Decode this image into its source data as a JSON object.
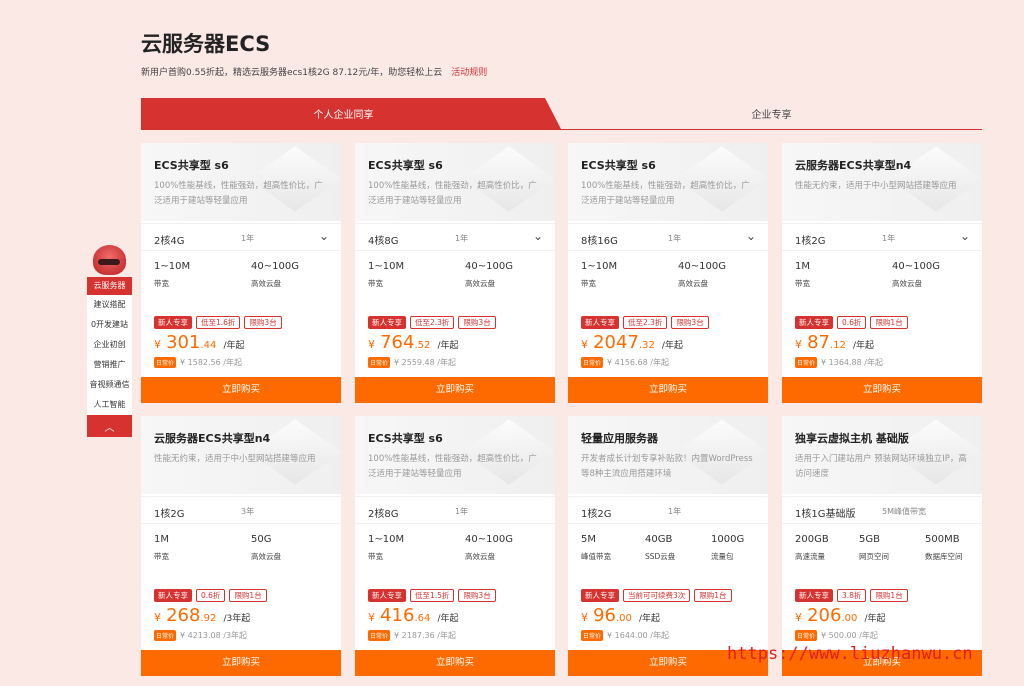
{
  "page": {
    "title": "云服务器ECS",
    "subtitle": "新用户首购0.55折起，精选云服务器ecs1核2G 87.12元/年，助您轻松上云",
    "rule_link": "活动规则"
  },
  "tabs": [
    "个人企业同享",
    "企业专享"
  ],
  "side_nav": {
    "active": "云服务器",
    "items": [
      "建议搭配",
      "0开发建站",
      "企业初创",
      "营销推广",
      "音视频通信",
      "人工智能"
    ]
  },
  "colors": {
    "brand_red": "#d6322f",
    "orange": "#ff6a00"
  },
  "watermark": "https://www.liuzhanwu.cn",
  "cards": [
    {
      "name": "ECS共享型 s6",
      "desc": "100%性能基线，性能强劲，超高性价比，广泛适用于建站等轻量应用",
      "config": "2核4G",
      "period": "1年",
      "chevron": true,
      "specs": [
        {
          "v": "1~10M",
          "l": "带宽"
        },
        {
          "v": "40~100G",
          "l": "高效云盘"
        }
      ],
      "tags": [
        "新人专享",
        "低至1.6折",
        "限购3台"
      ],
      "price_int": "301",
      "price_dec": ".44",
      "unit": "/年起",
      "orig_badge": "日常价",
      "orig": "¥ 1582.56 /年起",
      "buy": "立即购买"
    },
    {
      "name": "ECS共享型 s6",
      "desc": "100%性能基线，性能强劲，超高性价比，广泛适用于建站等轻量应用",
      "config": "4核8G",
      "period": "1年",
      "chevron": true,
      "specs": [
        {
          "v": "1~10M",
          "l": "带宽"
        },
        {
          "v": "40~100G",
          "l": "高效云盘"
        }
      ],
      "tags": [
        "新人专享",
        "低至2.3折",
        "限购3台"
      ],
      "price_int": "764",
      "price_dec": ".52",
      "unit": "/年起",
      "orig_badge": "日常价",
      "orig": "¥ 2559.48 /年起",
      "buy": "立即购买"
    },
    {
      "name": "ECS共享型 s6",
      "desc": "100%性能基线，性能强劲，超高性价比，广泛适用于建站等轻量应用",
      "config": "8核16G",
      "period": "1年",
      "chevron": true,
      "specs": [
        {
          "v": "1~10M",
          "l": "带宽"
        },
        {
          "v": "40~100G",
          "l": "高效云盘"
        }
      ],
      "tags": [
        "新人专享",
        "低至2.3折",
        "限购3台"
      ],
      "price_int": "2047",
      "price_dec": ".32",
      "unit": "/年起",
      "orig_badge": "日常价",
      "orig": "¥ 4156.68 /年起",
      "buy": "立即购买"
    },
    {
      "name": "云服务器ECS共享型n4",
      "desc": "性能无约束，适用于中小型网站搭建等应用",
      "config": "1核2G",
      "period": "1年",
      "chevron": true,
      "specs": [
        {
          "v": "1M",
          "l": "带宽"
        },
        {
          "v": "40~100G",
          "l": "高效云盘"
        }
      ],
      "tags": [
        "新人专享",
        "0.6折",
        "限购1台"
      ],
      "price_int": "87",
      "price_dec": ".12",
      "unit": "/年起",
      "orig_badge": "日常价",
      "orig": "¥ 1364.88 /年起",
      "buy": "立即购买"
    },
    {
      "name": "云服务器ECS共享型n4",
      "desc": "性能无约束，适用于中小型网站搭建等应用",
      "config": "1核2G",
      "period": "3年",
      "chevron": false,
      "specs": [
        {
          "v": "1M",
          "l": "带宽"
        },
        {
          "v": "50G",
          "l": "高效云盘"
        }
      ],
      "tags": [
        "新人专享",
        "0.6折",
        "限购1台"
      ],
      "price_int": "268",
      "price_dec": ".92",
      "unit": "/3年起",
      "orig_badge": "日常价",
      "orig": "¥ 4213.08 /3年起",
      "buy": "立即购买"
    },
    {
      "name": "ECS共享型 s6",
      "desc": "100%性能基线，性能强劲，超高性价比，广泛适用于建站等轻量应用",
      "config": "2核8G",
      "period": "1年",
      "chevron": false,
      "specs": [
        {
          "v": "1~10M",
          "l": "带宽"
        },
        {
          "v": "40~100G",
          "l": "高效云盘"
        }
      ],
      "tags": [
        "新人专享",
        "低至1.5折",
        "限购3台"
      ],
      "price_int": "416",
      "price_dec": ".64",
      "unit": "/年起",
      "orig_badge": "日常价",
      "orig": "¥ 2187.36 /年起",
      "buy": "立即购买"
    },
    {
      "name": "轻量应用服务器",
      "desc": "开发者成长计划专享补贴款！内置WordPress等8种主流应用搭建环境",
      "config": "1核2G",
      "period": "1年",
      "chevron": false,
      "specs": [
        {
          "v": "5M",
          "l": "峰值带宽"
        },
        {
          "v": "40GB",
          "l": "SSD云盘"
        },
        {
          "v": "1000G",
          "l": "流量包"
        }
      ],
      "tags": [
        "新人专享",
        "当前可可续费3次",
        "限购1台"
      ],
      "price_int": "96",
      "price_dec": ".00",
      "unit": "/年起",
      "orig_badge": "日常价",
      "orig": "¥ 1644.00 /年起",
      "buy": "立即购买"
    },
    {
      "name": "独享云虚拟主机 基础版",
      "desc": "适用于入门建站用户 预装网站环境独立IP，高访问速度",
      "config": "1核1G基础版",
      "period": "5M峰值带宽",
      "chevron": false,
      "specs": [
        {
          "v": "200GB",
          "l": "高速流量"
        },
        {
          "v": "5GB",
          "l": "网页空间"
        },
        {
          "v": "500MB",
          "l": "数据库空间"
        }
      ],
      "tags": [
        "新人专享",
        "3.8折",
        "限购1台"
      ],
      "price_int": "206",
      "price_dec": ".00",
      "unit": "/年起",
      "orig_badge": "日常价",
      "orig": "¥ 500.00 /年起",
      "buy": "立即购买"
    }
  ]
}
